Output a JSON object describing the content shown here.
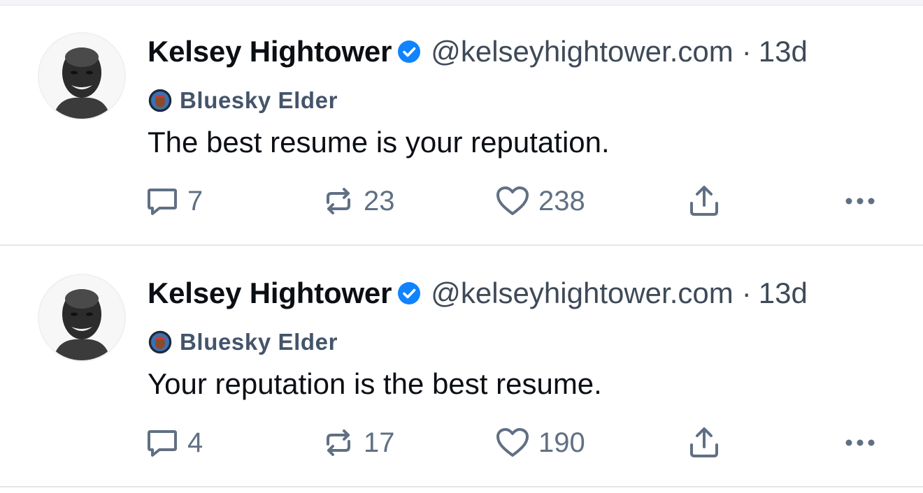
{
  "posts": [
    {
      "author": {
        "display_name": "Kelsey Hightower",
        "handle": "@kelseyhightower.com",
        "verified": true,
        "avatar_icon": "avatar-photo"
      },
      "separator": "·",
      "time": "13d",
      "badge": {
        "label": "Bluesky Elder",
        "icon": "badge-avatar-icon"
      },
      "text": "The best resume is your reputation.",
      "actions": {
        "replies": "7",
        "reposts": "23",
        "likes": "238"
      }
    },
    {
      "author": {
        "display_name": "Kelsey Hightower",
        "handle": "@kelseyhightower.com",
        "verified": true,
        "avatar_icon": "avatar-photo"
      },
      "separator": "·",
      "time": "13d",
      "badge": {
        "label": "Bluesky Elder",
        "icon": "badge-avatar-icon"
      },
      "text": "Your reputation is the best resume.",
      "actions": {
        "replies": "4",
        "reposts": "17",
        "likes": "190"
      }
    }
  ],
  "icons": {
    "reply": "speech-bubble-icon",
    "repost": "repost-arrows-icon",
    "like": "heart-icon",
    "share": "share-upload-icon",
    "more": "more-dots-icon",
    "verified": "verified-check-icon"
  },
  "colors": {
    "verified_blue": "#1083fe",
    "action_gray": "#607084",
    "meta_gray": "#3f4a58",
    "badge_text": "#44546a"
  }
}
